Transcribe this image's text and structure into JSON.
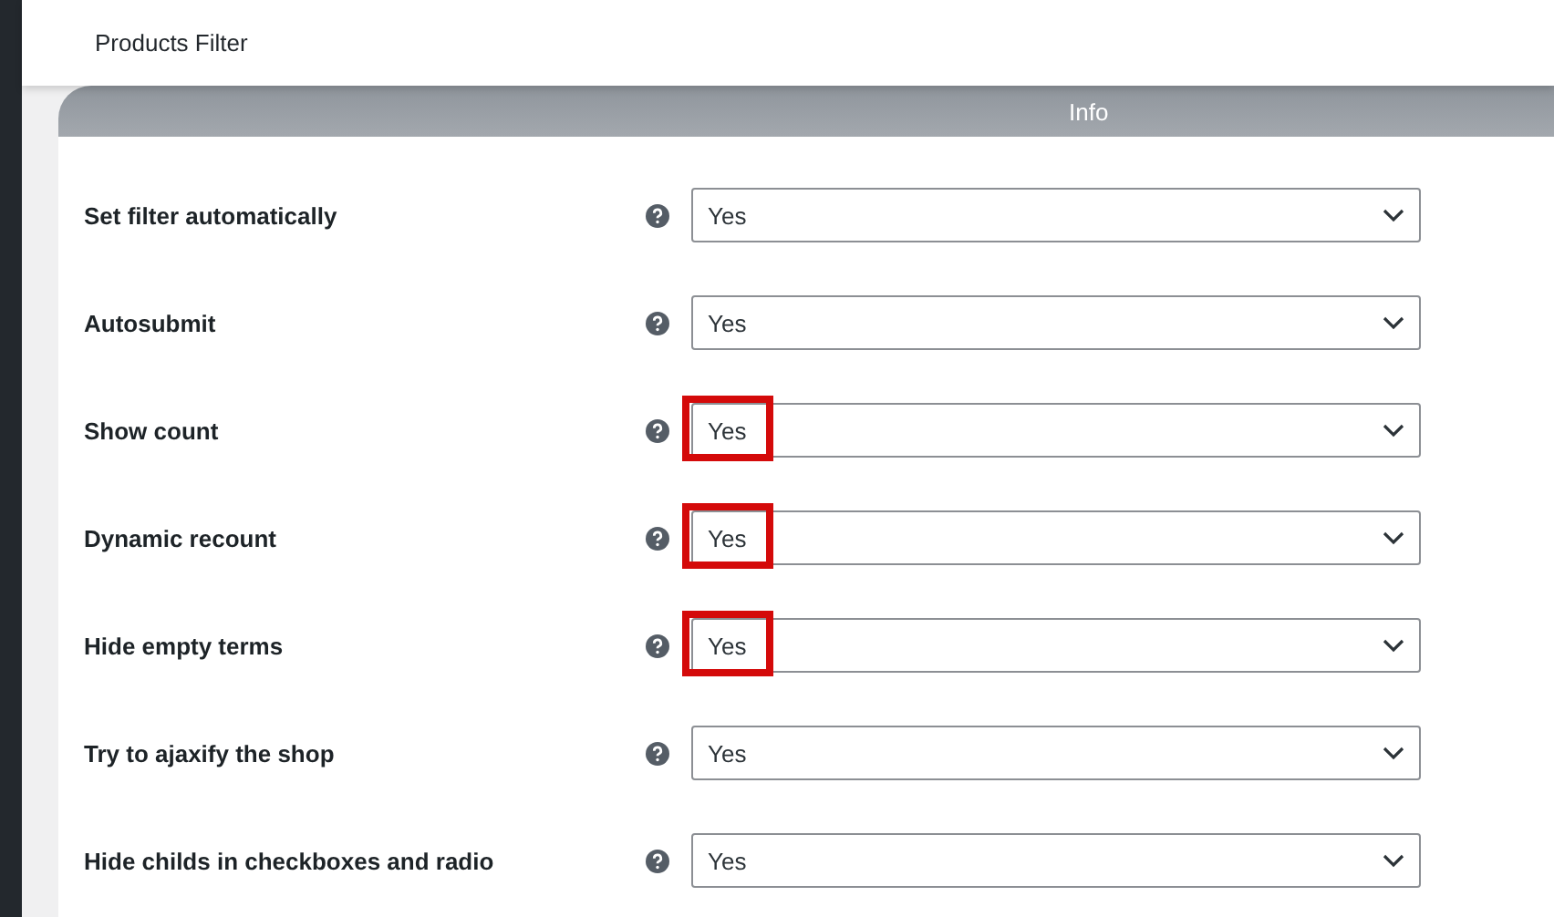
{
  "header": {
    "title": "Products Filter"
  },
  "tabs": [
    {
      "label": "Info",
      "selected": false
    }
  ],
  "fields": [
    {
      "label": "Set filter automatically",
      "value": "Yes",
      "highlighted": false
    },
    {
      "label": "Autosubmit",
      "value": "Yes",
      "highlighted": false
    },
    {
      "label": "Show count",
      "value": "Yes",
      "highlighted": true
    },
    {
      "label": "Dynamic recount",
      "value": "Yes",
      "highlighted": true
    },
    {
      "label": "Hide empty terms",
      "value": "Yes",
      "highlighted": true
    },
    {
      "label": "Try to ajaxify the shop",
      "value": "Yes",
      "highlighted": false
    },
    {
      "label": "Hide childs in checkboxes and radio",
      "value": "Yes",
      "highlighted": false
    }
  ]
}
